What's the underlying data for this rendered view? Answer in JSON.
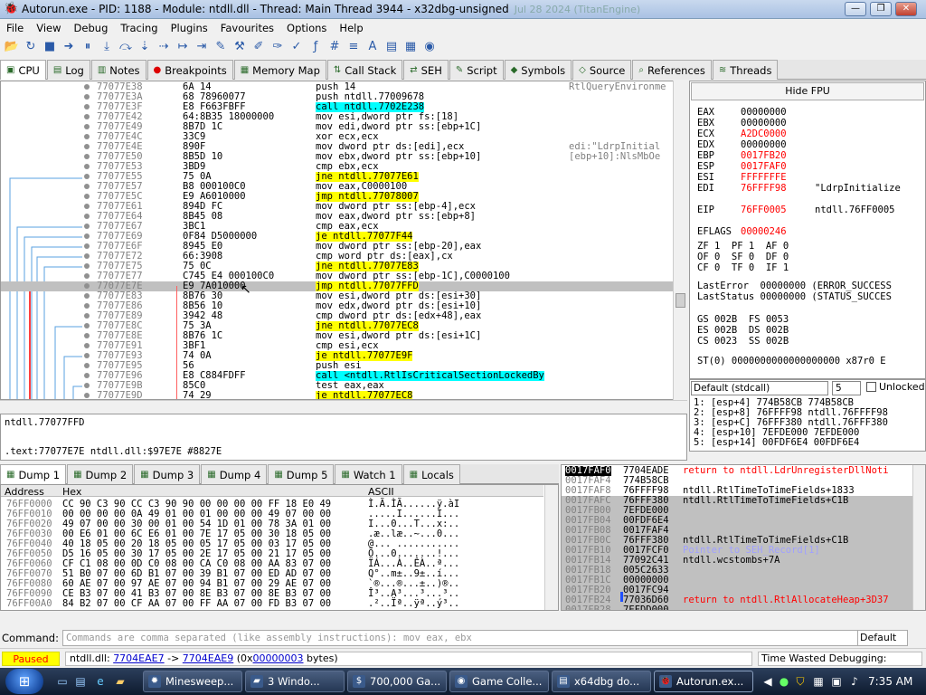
{
  "window": {
    "title": "Autorun.exe - PID: 1188 - Module: ntdll.dll - Thread: Main Thread 3944 - x32dbg-unsigned",
    "build": "Jul 28 2024 (TitanEngine)",
    "buttons": [
      "—",
      "❐",
      "✕"
    ]
  },
  "menu": [
    "File",
    "View",
    "Debug",
    "Tracing",
    "Plugins",
    "Favourites",
    "Options",
    "Help"
  ],
  "toolbar_icons": [
    "open-icon",
    "restart-icon",
    "stop-icon",
    "run-icon",
    "pause-icon",
    "step-into-icon",
    "step-over-icon",
    "trace-into-icon",
    "trace-over-icon",
    "execute-till-return-icon",
    "run-to-user-code-icon",
    "scylla-icon",
    "patch-icon",
    "comment-icon",
    "label-icon",
    "bookmark-icon",
    "function-icon",
    "hash-icon",
    "list-icon",
    "font-icon",
    "preferences-icon",
    "calculator-icon",
    "globe-icon"
  ],
  "tabs": [
    {
      "label": "CPU",
      "icon": "cpu-icon",
      "active": true
    },
    {
      "label": "Log",
      "icon": "log-icon"
    },
    {
      "label": "Notes",
      "icon": "notes-icon"
    },
    {
      "label": "Breakpoints",
      "icon": "breakpoint-icon"
    },
    {
      "label": "Memory Map",
      "icon": "memory-icon"
    },
    {
      "label": "Call Stack",
      "icon": "callstack-icon"
    },
    {
      "label": "SEH",
      "icon": "seh-icon"
    },
    {
      "label": "Script",
      "icon": "script-icon"
    },
    {
      "label": "Symbols",
      "icon": "symbols-icon"
    },
    {
      "label": "Source",
      "icon": "source-icon"
    },
    {
      "label": "References",
      "icon": "references-icon"
    },
    {
      "label": "Threads",
      "icon": "threads-icon"
    }
  ],
  "disasm": [
    {
      "addr": "77077E38",
      "bytes": "6A 14",
      "ins": "push 14",
      "cmt": "RtlQueryEnvironme"
    },
    {
      "addr": "77077E3A",
      "bytes": "68 78960077",
      "ins": "push ntdll.77009678",
      "cmt": ""
    },
    {
      "addr": "77077E3F",
      "bytes": "E8 F663FBFF",
      "ins": "call ntdll.7702E238",
      "cmt": "",
      "kind": "call"
    },
    {
      "addr": "77077E42",
      "bytes": "64:8B35 18000000",
      "ins": "mov esi,dword ptr fs:[18]",
      "cmt": ""
    },
    {
      "addr": "77077E49",
      "bytes": "8B7D 1C",
      "ins": "mov edi,dword ptr ss:[ebp+1C]",
      "cmt": ""
    },
    {
      "addr": "77077E4C",
      "bytes": "33C9",
      "ins": "xor ecx,ecx",
      "cmt": ""
    },
    {
      "addr": "77077E4E",
      "bytes": "890F",
      "ins": "mov dword ptr ds:[edi],ecx",
      "cmt": "edi:\"LdrpInitial"
    },
    {
      "addr": "77077E50",
      "bytes": "8B5D 10",
      "ins": "mov ebx,dword ptr ss:[ebp+10]",
      "cmt": "[ebp+10]:NlsMbOe"
    },
    {
      "addr": "77077E53",
      "bytes": "3BD9",
      "ins": "cmp ebx,ecx",
      "cmt": ""
    },
    {
      "addr": "77077E55",
      "bytes": "75 0A",
      "ins": "jne ntdll.77077E61",
      "cmt": "",
      "kind": "jmp"
    },
    {
      "addr": "77077E57",
      "bytes": "B8 000100C0",
      "ins": "mov eax,C0000100",
      "cmt": ""
    },
    {
      "addr": "77077E5C",
      "bytes": "E9 A6010000",
      "ins": "jmp ntdll.77078007",
      "cmt": "",
      "kind": "jmp"
    },
    {
      "addr": "77077E61",
      "bytes": "894D FC",
      "ins": "mov dword ptr ss:[ebp-4],ecx",
      "cmt": ""
    },
    {
      "addr": "77077E64",
      "bytes": "8B45 08",
      "ins": "mov eax,dword ptr ss:[ebp+8]",
      "cmt": ""
    },
    {
      "addr": "77077E67",
      "bytes": "3BC1",
      "ins": "cmp eax,ecx",
      "cmt": ""
    },
    {
      "addr": "77077E69",
      "bytes": "0F84 D5000000",
      "ins": "je ntdll.77077F44",
      "cmt": "",
      "kind": "jmp"
    },
    {
      "addr": "77077E6F",
      "bytes": "8945 E0",
      "ins": "mov dword ptr ss:[ebp-20],eax",
      "cmt": ""
    },
    {
      "addr": "77077E72",
      "bytes": "66:3908",
      "ins": "cmp word ptr ds:[eax],cx",
      "cmt": ""
    },
    {
      "addr": "77077E75",
      "bytes": "75 0C",
      "ins": "jne ntdll.77077E83",
      "cmt": "",
      "kind": "jmp"
    },
    {
      "addr": "77077E77",
      "bytes": "C745 E4 000100C0",
      "ins": "mov dword ptr ss:[ebp-1C],C0000100",
      "cmt": ""
    },
    {
      "addr": "77077E7E",
      "bytes": "E9 7A010000",
      "ins": "jmp ntdll.77077FFD",
      "cmt": "",
      "kind": "jmp",
      "sel": true
    },
    {
      "addr": "77077E83",
      "bytes": "8B76 30",
      "ins": "mov esi,dword ptr ds:[esi+30]",
      "cmt": ""
    },
    {
      "addr": "77077E86",
      "bytes": "8B56 10",
      "ins": "mov edx,dword ptr ds:[esi+10]",
      "cmt": ""
    },
    {
      "addr": "77077E89",
      "bytes": "3942 48",
      "ins": "cmp dword ptr ds:[edx+48],eax",
      "cmt": ""
    },
    {
      "addr": "77077E8C",
      "bytes": "75 3A",
      "ins": "jne ntdll.77077EC8",
      "cmt": "",
      "kind": "jmp"
    },
    {
      "addr": "77077E8E",
      "bytes": "8B76 1C",
      "ins": "mov esi,dword ptr ds:[esi+1C]",
      "cmt": ""
    },
    {
      "addr": "77077E91",
      "bytes": "3BF1",
      "ins": "cmp esi,ecx",
      "cmt": ""
    },
    {
      "addr": "77077E93",
      "bytes": "74 0A",
      "ins": "je ntdll.77077E9F",
      "cmt": "",
      "kind": "jmp"
    },
    {
      "addr": "77077E95",
      "bytes": "56",
      "ins": "push esi",
      "cmt": ""
    },
    {
      "addr": "77077E96",
      "bytes": "E8 C884FDFF",
      "ins": "call <ntdll.RtlIsCriticalSectionLockedBy",
      "cmt": "",
      "kind": "call"
    },
    {
      "addr": "77077E9B",
      "bytes": "85C0",
      "ins": "test eax,eax",
      "cmt": ""
    },
    {
      "addr": "77077E9D",
      "bytes": "74 29",
      "ins": "je ntdll.77077EC8",
      "cmt": "",
      "kind": "jmp"
    }
  ],
  "registers": {
    "hide_fpu": "Hide FPU",
    "lines": [
      {
        "name": "EAX",
        "val": "00000000",
        "info": ""
      },
      {
        "name": "EBX",
        "val": "00000000",
        "info": ""
      },
      {
        "name": "ECX",
        "val": "A2DC0000",
        "info": "",
        "changed": true
      },
      {
        "name": "EDX",
        "val": "00000000",
        "info": ""
      },
      {
        "name": "EBP",
        "val": "0017FB20",
        "info": "",
        "changed": true
      },
      {
        "name": "ESP",
        "val": "0017FAF0",
        "info": "",
        "changed": true
      },
      {
        "name": "ESI",
        "val": "FFFFFFFE",
        "info": "",
        "changed": true
      },
      {
        "name": "EDI",
        "val": "76FFFF98",
        "info": "\"LdrpInitialize",
        "changed": true
      },
      {
        "name": "",
        "val": "",
        "info": ""
      },
      {
        "name": "EIP",
        "val": "76FF0005",
        "info": "ntdll.76FF0005",
        "changed": true
      },
      {
        "name": "",
        "val": "",
        "info": ""
      },
      {
        "name": "EFLAGS",
        "val": "00000246",
        "info": "",
        "changed": true
      }
    ],
    "flags": [
      "ZF 1  PF 1  AF 0",
      "OF 0  SF 0  DF 0",
      "CF 0  TF 0  IF 1"
    ],
    "last_error": "LastError  00000000 (ERROR_SUCCESS",
    "last_status": "LastStatus 00000000 (STATUS_SUCCES",
    "segs": [
      "GS 002B  FS 0053",
      "ES 002B  DS 002B",
      "CS 0023  SS 002B"
    ],
    "st0": "ST(0) 0000000000000000000 x87r0 E"
  },
  "callconv": {
    "selected": "Default (stdcall)",
    "count": "5",
    "unlocked": "Unlocked",
    "params": [
      "1: [esp+4] 774B58CB 774B58CB",
      "2: [esp+8] 76FFFF98 ntdll.76FFFF98",
      "3: [esp+C] 76FFF380 ntdll.76FFF380",
      "4: [esp+10] 7EFDE000 7EFDE000",
      "5: [esp+14] 00FDF6E4 00FDF6E4"
    ]
  },
  "info": {
    "target": "ntdll.77077FFD",
    "location": ".text:77077E7E ntdll.dll:$97E7E #8827E"
  },
  "dump_tabs": [
    "Dump 1",
    "Dump 2",
    "Dump 3",
    "Dump 4",
    "Dump 5",
    "Watch 1",
    "Locals"
  ],
  "dump_tab_icons": [
    "dump-icon",
    "dump-icon",
    "dump-icon",
    "dump-icon",
    "dump-icon",
    "watch-icon",
    "locals-icon"
  ],
  "dump_header": {
    "addr": "Address",
    "hex": "Hex",
    "ascii": "ASCII"
  },
  "dump": [
    {
      "a": "76FF0000",
      "h": "CC 90 C3 90 CC C3 90 90 00 00 00 00 FF 18 E0 49",
      "s": "Ì.Ã.ÌÃ......ÿ.àI"
    },
    {
      "a": "76FF0010",
      "h": "00 00 00 00 0A 49 01 00 01 00 00 00 49 07 00 00",
      "s": ".....I......I..."
    },
    {
      "a": "76FF0020",
      "h": "49 07 00 00 30 00 01 00 54 1D 01 00 78 3A 01 00",
      "s": "I...0...T...x:.."
    },
    {
      "a": "76FF0030",
      "h": "00 E6 01 00 6C E6 01 00 7E 17 05 00 30 18 05 00",
      "s": ".æ..læ..~...0..."
    },
    {
      "a": "76FF0040",
      "h": "40 18 05 00 20 18 05 00 05 17 05 00 03 17 05 00",
      "s": "@... ..........."
    },
    {
      "a": "76FF0050",
      "h": "D5 16 05 00 30 17 05 00 2E 17 05 00 21 17 05 00",
      "s": "Õ...0.......!..."
    },
    {
      "a": "76FF0060",
      "h": "CF C1 08 00 0D C0 08 00 CA C0 08 00 AA 83 07 00",
      "s": "ÏÁ...À..ÊÀ..ª..."
    },
    {
      "a": "76FF0070",
      "h": "51 B0 07 00 6D B1 07 00 39 B1 07 00 ED AD 07 00",
      "s": "Q°..m±..9±..í..."
    },
    {
      "a": "76FF0080",
      "h": "60 AE 07 00 97 AE 07 00 94 B1 07 00 29 AE 07 00",
      "s": "`®...®...±..)®.."
    },
    {
      "a": "76FF0090",
      "h": "CE B3 07 00 41 B3 07 00 8E B3 07 00 8E B3 07 00",
      "s": "Î³..A³...³...³.."
    },
    {
      "a": "76FF00A0",
      "h": "84 B2 07 00 CF AA 07 00 FF AA 07 00 FD B3 07 00",
      "s": ".²..Ïª..ÿª..ý³.."
    }
  ],
  "stack": [
    {
      "a": "0017FAF0",
      "v": "7704EADE",
      "c": "return to ntdll.LdrUnregisterDllNoti",
      "cur": true,
      "red": true
    },
    {
      "a": "0017FAF4",
      "v": "774B58CB",
      "c": ""
    },
    {
      "a": "0017FAF8",
      "v": "76FFFF98",
      "c": "ntdll.RtlTimeToTimeFields+1833"
    },
    {
      "a": "0017FAFC",
      "v": "76FFF380",
      "c": "ntdll.RtlTimeToTimeFields+C1B",
      "g": true
    },
    {
      "a": "0017FB00",
      "v": "7EFDE000",
      "c": "",
      "g": true
    },
    {
      "a": "0017FB04",
      "v": "00FDF6E4",
      "c": "",
      "g": true
    },
    {
      "a": "0017FB08",
      "v": "0017FAF4",
      "c": "",
      "g": true
    },
    {
      "a": "0017FB0C",
      "v": "76FFF380",
      "c": "ntdll.RtlTimeToTimeFields+C1B",
      "g": true
    },
    {
      "a": "0017FB10",
      "v": "0017FCF0",
      "c": "Pointer to SEH_Record[1]",
      "g": true,
      "seh": true
    },
    {
      "a": "0017FB14",
      "v": "77092C41",
      "c": "ntdll.wcstombs+7A",
      "g": true
    },
    {
      "a": "0017FB18",
      "v": "005C2633",
      "c": "",
      "g": true
    },
    {
      "a": "0017FB1C",
      "v": "00000000",
      "c": "",
      "g": true
    },
    {
      "a": "0017FB20",
      "v": "0017FC94",
      "c": "",
      "g": true
    },
    {
      "a": "0017FB24",
      "v": "77036D60",
      "c": "return to ntdll.RtlAllocateHeap+3D37",
      "g": true,
      "red": true
    },
    {
      "a": "0017FB28",
      "v": "7EFDD000",
      "c": "",
      "g": true
    }
  ],
  "command": {
    "label": "Command:",
    "placeholder": "Commands are comma separated (like assembly instructions): mov eax, ebx",
    "default": "Default"
  },
  "status": {
    "state": "Paused",
    "prefix": "ntdll.dll: ",
    "from": "7704EAE7",
    "arrow": " -> ",
    "to": "7704EAE9",
    "size_open": " (0x",
    "size": "00000003",
    "size_close": " bytes)",
    "time": "Time Wasted Debugging: 0:00:01:10"
  },
  "taskbar": {
    "items": [
      {
        "label": "Minesweep...",
        "icon": "minesweeper-icon"
      },
      {
        "label": "3 Windo...",
        "icon": "folder-icon"
      },
      {
        "label": "700,000 Ga...",
        "icon": "dollar-icon"
      },
      {
        "label": "Game Colle...",
        "icon": "game-icon"
      },
      {
        "label": "x64dbg do...",
        "icon": "doc-icon"
      },
      {
        "label": "Autorun.ex...",
        "icon": "bug-icon",
        "active": true
      }
    ],
    "clock": "7:35 AM"
  }
}
